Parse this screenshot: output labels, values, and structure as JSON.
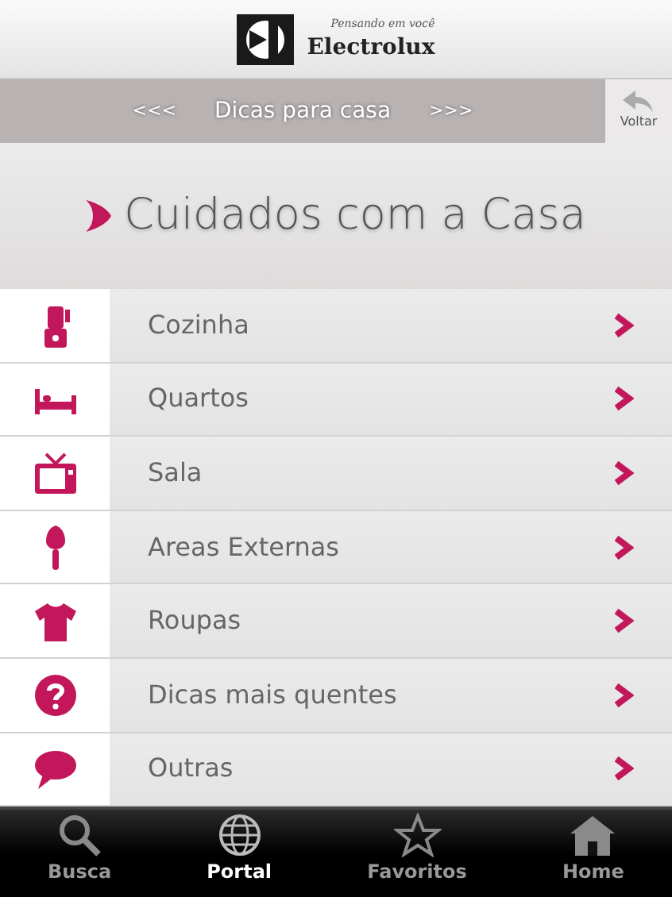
{
  "header": {
    "tagline": "Pensando em você",
    "brand": "Electrolux"
  },
  "nav_bar": {
    "prev": "<<<",
    "title": "Dicas para casa",
    "next": ">>>",
    "back_button": "Voltar"
  },
  "heading": "Cuidados com a Casa",
  "categories": [
    {
      "label": "Cozinha",
      "kind": "blender"
    },
    {
      "label": "Quartos",
      "kind": "bed"
    },
    {
      "label": "Sala",
      "kind": "tv"
    },
    {
      "label": "Areas Externas",
      "kind": "trowel"
    },
    {
      "label": "Roupas",
      "kind": "shirt"
    },
    {
      "label": "Dicas mais quentes",
      "kind": "question"
    },
    {
      "label": "Outras",
      "kind": "speech"
    }
  ],
  "tab_bar": [
    {
      "label": "Busca",
      "kind": "search",
      "selected": false
    },
    {
      "label": "Portal",
      "kind": "globe",
      "selected": true
    },
    {
      "label": "Favoritos",
      "kind": "star",
      "selected": false
    },
    {
      "label": "Home",
      "kind": "home",
      "selected": false
    }
  ]
}
